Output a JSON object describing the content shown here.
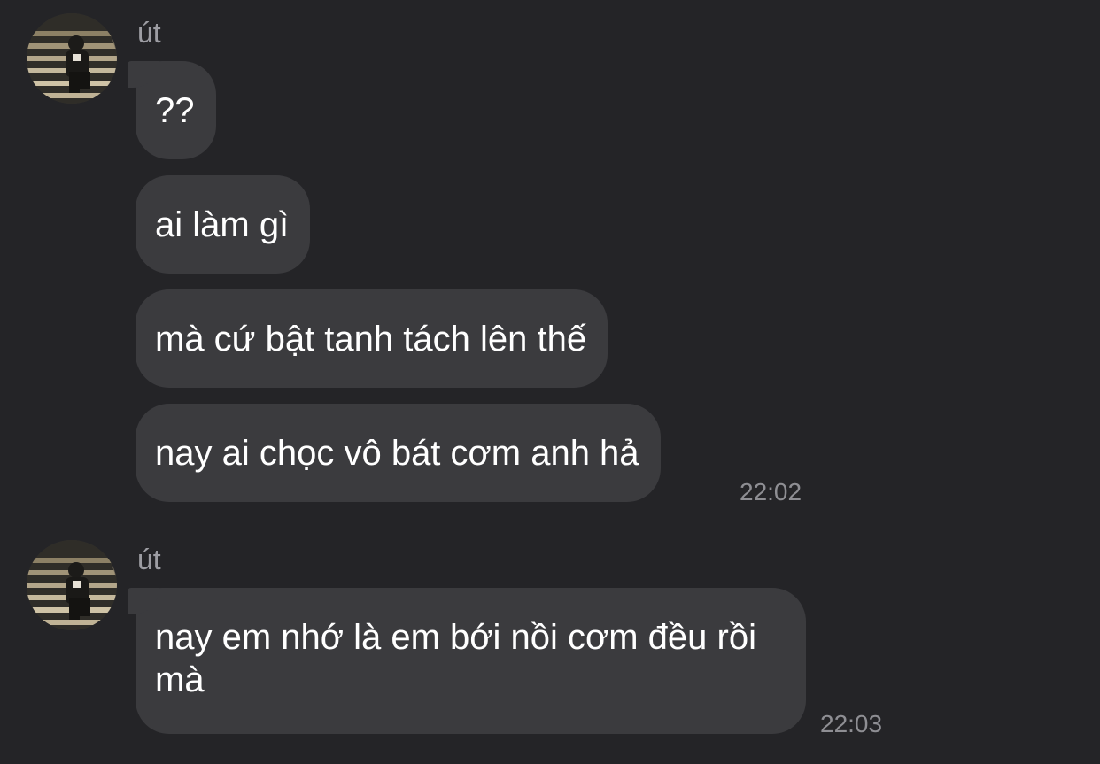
{
  "groups": [
    {
      "sender": "út",
      "avatar_icon": "profile-photo-person-on-stairs",
      "messages": [
        "??",
        "ai làm gì",
        "mà cứ bật tanh tách lên thế",
        "nay ai chọc vô bát cơm anh hả"
      ],
      "time": "22:02"
    },
    {
      "sender": "út",
      "avatar_icon": "profile-photo-person-on-stairs",
      "messages": [
        "nay em nhớ là em bới nồi cơm đều rồi mà"
      ],
      "time": "22:03"
    }
  ],
  "colors": {
    "background": "#242427",
    "bubble": "#3b3b3e",
    "text": "#ffffff",
    "meta": "#8e8e93"
  }
}
